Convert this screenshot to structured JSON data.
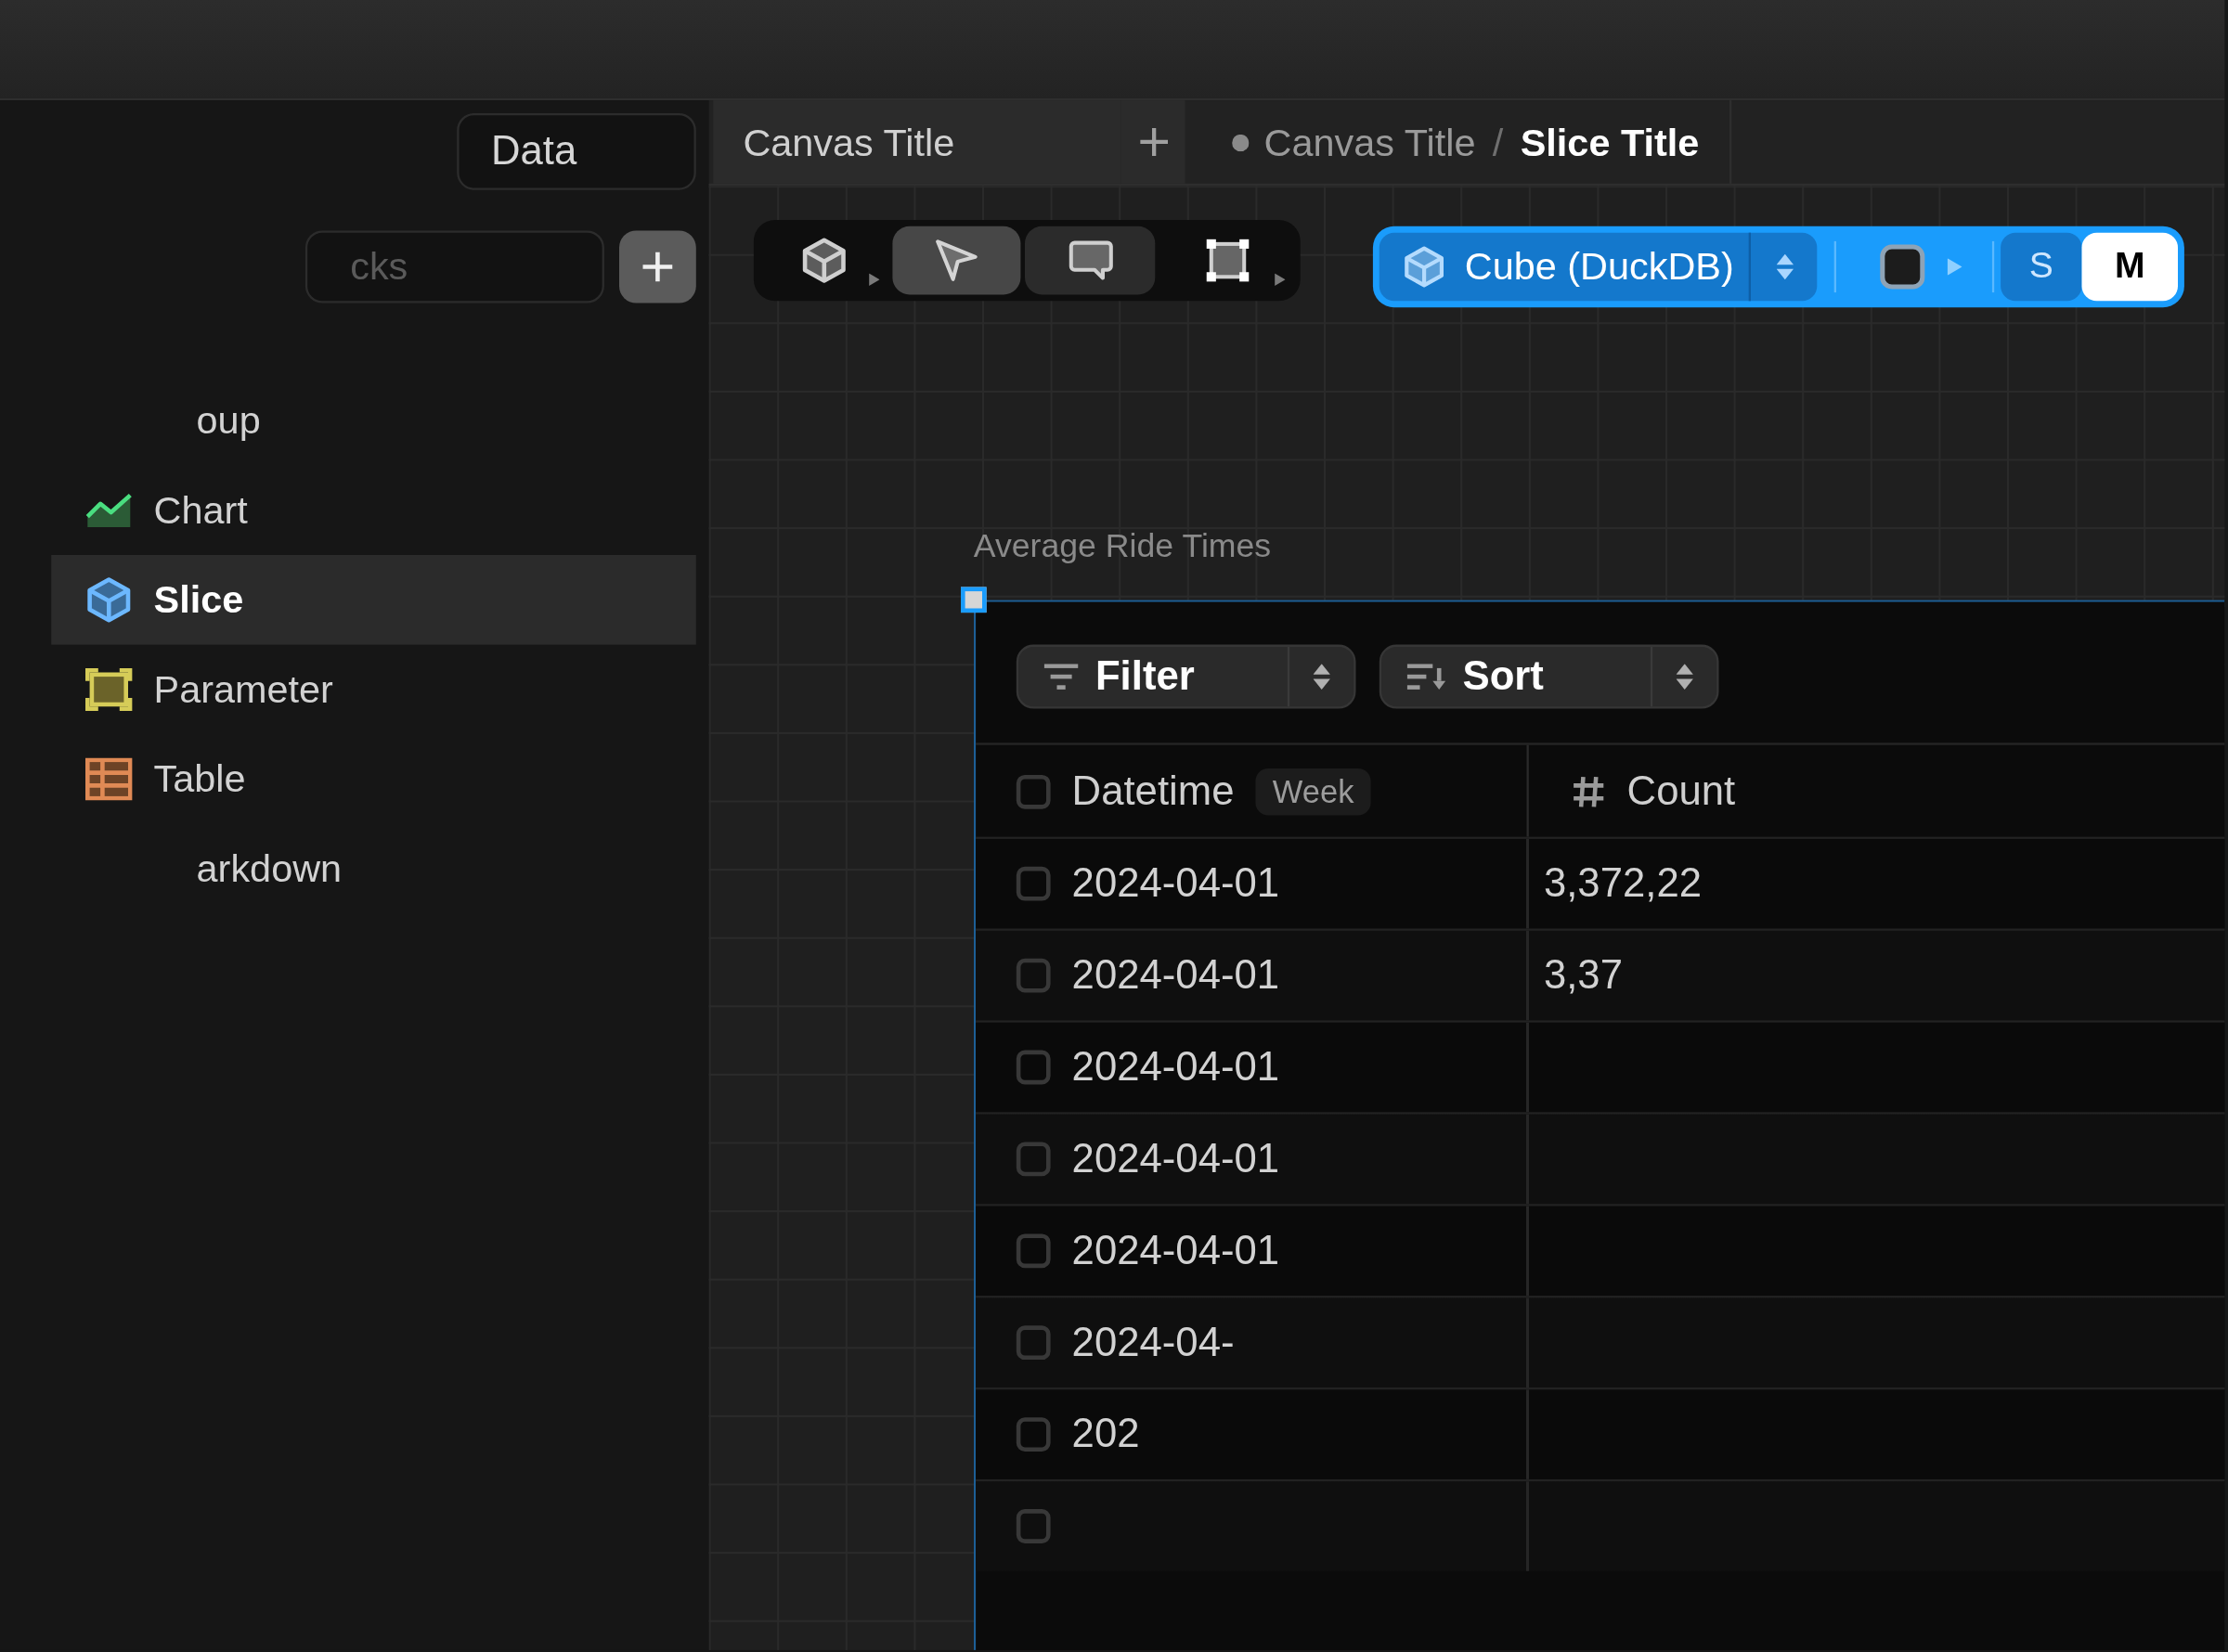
{
  "sidebar": {
    "tab": {
      "label": "Data"
    },
    "search": {
      "placeholder": "cks"
    },
    "items": [
      {
        "label": "oup",
        "selected": false
      },
      {
        "label": "Chart",
        "kind": "chart",
        "selected": false
      },
      {
        "label": "Slice",
        "kind": "slice",
        "selected": true
      },
      {
        "label": "Parameter",
        "kind": "parameter",
        "selected": false
      },
      {
        "label": "Table",
        "kind": "table",
        "selected": false
      },
      {
        "label": "arkdown",
        "selected": false
      }
    ]
  },
  "header": {
    "tab": {
      "label": "Canvas Title"
    },
    "breadcrumb": [
      {
        "label": "Canvas Title",
        "current": false
      },
      {
        "label": "Slice Title",
        "current": true
      }
    ],
    "separator": "/"
  },
  "toolbar": {
    "tools": [
      {
        "kind": "cube",
        "selected": false,
        "hovered": false,
        "has_menu": true
      },
      {
        "kind": "pointer",
        "selected": true,
        "hovered": false,
        "has_menu": false
      },
      {
        "kind": "comment",
        "selected": false,
        "hovered": true,
        "has_menu": false
      },
      {
        "kind": "rectangle",
        "selected": false,
        "hovered": false,
        "has_menu": true
      }
    ]
  },
  "slice_toolbar": {
    "source": {
      "label": "Cube (DuckDB)"
    },
    "shape": {
      "has_menu": true
    },
    "sizes": [
      {
        "label": "S",
        "selected": false
      },
      {
        "label": "M",
        "selected": true
      }
    ]
  },
  "block": {
    "title": "Average Ride Times",
    "selected": true,
    "filter": {
      "label": "Filter"
    },
    "sort": {
      "label": "Sort"
    },
    "table": {
      "header_checkbox": {
        "checked": false
      },
      "columns": [
        {
          "kind": "datetime",
          "label": "Datetime",
          "tag": "Week"
        },
        {
          "kind": "number",
          "label": "Count"
        }
      ],
      "rows": [
        {
          "checked": false,
          "cells": [
            "2024-04-01",
            "3,372,22"
          ]
        },
        {
          "checked": false,
          "cells": [
            "2024-04-01",
            "3,37"
          ]
        },
        {
          "checked": false,
          "cells": [
            "2024-04-01"
          ]
        },
        {
          "checked": false,
          "cells": [
            "2024-04-01"
          ]
        },
        {
          "checked": false,
          "cells": [
            "2024-04-01"
          ]
        },
        {
          "checked": false,
          "cells": [
            "2024-04-"
          ]
        },
        {
          "checked": false,
          "cells": [
            "202"
          ]
        },
        {
          "checked": false
        }
      ]
    }
  }
}
